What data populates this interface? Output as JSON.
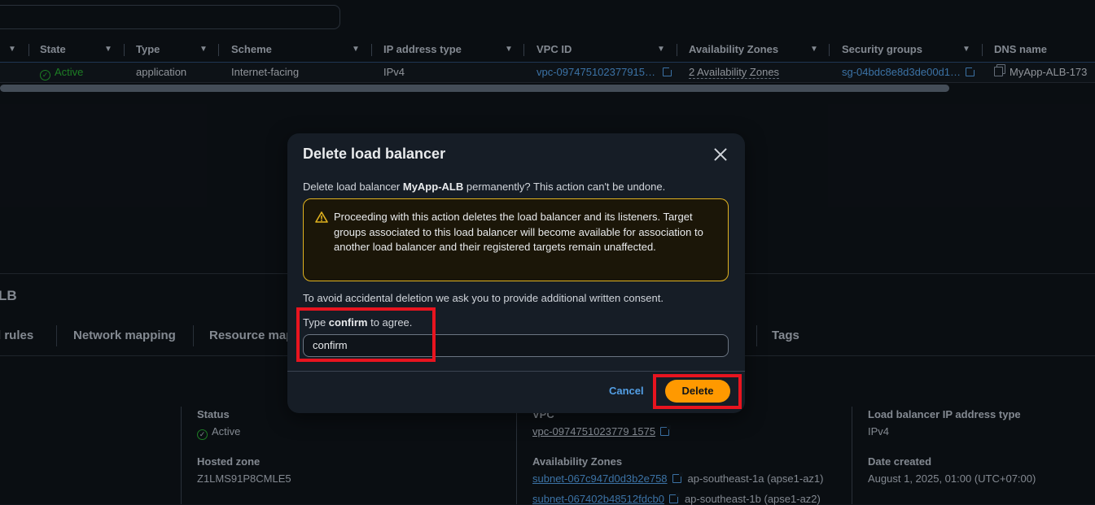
{
  "table": {
    "columns": [
      "State",
      "Type",
      "Scheme",
      "IP address type",
      "VPC ID",
      "Availability Zones",
      "Security groups",
      "DNS name"
    ],
    "row": {
      "state": "Active",
      "type": "application",
      "scheme": "Internet-facing",
      "ip_type": "IPv4",
      "vpc": "vpc-097475102377915…",
      "azs": "2 Availability Zones",
      "sg": "sg-04bdc8e8d3de00d1…",
      "dns": "MyApp-ALB-173"
    }
  },
  "details": {
    "title": "LB",
    "tabs": [
      "d rules",
      "Network mapping",
      "Resource map",
      "Tags"
    ],
    "status_label": "Status",
    "status_value": "Active",
    "hosted_zone_label": "Hosted zone",
    "hosted_zone_value": "Z1LMS91P8CMLE5",
    "vpc_label": "VPC",
    "vpc_value": "vpc-0974751023779 1575",
    "az_label": "Availability Zones",
    "subnet1": "subnet-067c947d0d3b2e758",
    "subnet1_zone": "ap-southeast-1a (apse1-az1)",
    "subnet2": "subnet-067402b48512fdcb0",
    "subnet2_zone": "ap-southeast-1b (apse1-az2)",
    "ip_type_label": "Load balancer IP address type",
    "ip_type_value": "IPv4",
    "created_label": "Date created",
    "created_value": "August 1, 2025, 01:00 (UTC+07:00)"
  },
  "modal": {
    "title": "Delete load balancer",
    "desc_prefix": "Delete load balancer ",
    "lb_name": "MyApp-ALB",
    "desc_suffix": " permanently? This action can't be undone.",
    "warning": "Proceeding with this action deletes the load balancer and its listeners. Target groups associated to this load balancer will become available for association to another load balancer and their registered targets remain unaffected.",
    "consent_text": "To avoid accidental deletion we ask you to provide additional written consent.",
    "type_prefix": "Type ",
    "type_word": "confirm",
    "type_suffix": " to agree.",
    "input_value": "confirm",
    "cancel_label": "Cancel",
    "delete_label": "Delete"
  },
  "colors": {
    "accent": "#ff9900",
    "link": "#539fe5",
    "success": "#29ad32",
    "warning_border": "#e0b21f",
    "highlight": "#e8141f"
  },
  "icons": [
    "sort-caret-icon",
    "status-active-icon",
    "external-link-icon",
    "copy-icon",
    "warning-icon",
    "close-icon"
  ]
}
